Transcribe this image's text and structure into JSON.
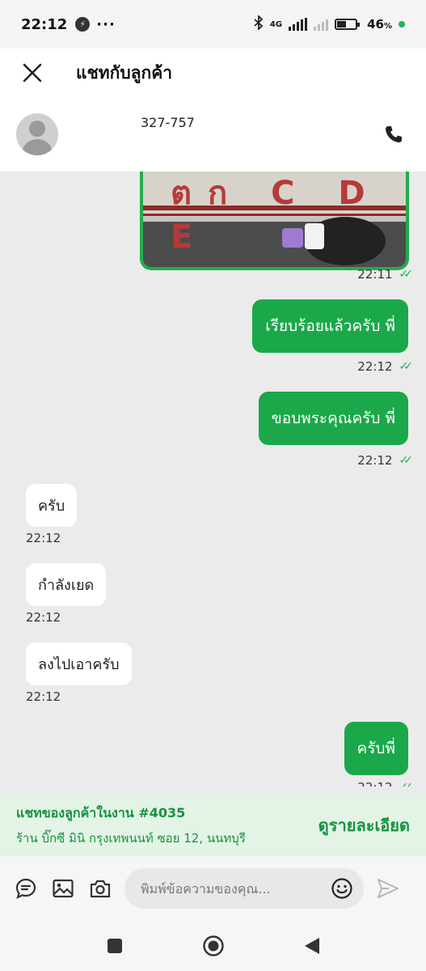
{
  "status_bar": {
    "time": "22:12",
    "dots": "···",
    "network": "4G",
    "battery": "46",
    "battery_unit": "%"
  },
  "header": {
    "title": "แชทกับลูกค้า"
  },
  "contact": {
    "phone_partial": "327-757"
  },
  "chat": {
    "image_caption_text": "ตก C D E",
    "image_time": "22:11",
    "outgoing": [
      {
        "text": "เรียบร้อยแล้วครับ พี่",
        "time": "22:12"
      },
      {
        "text": "ขอบพระคุณครับ พี่",
        "time": "22:12"
      },
      {
        "text": "ครับพี่",
        "time": "22:12"
      }
    ],
    "incoming": [
      {
        "text": "ครับ",
        "time": "22:12"
      },
      {
        "text": "กำลังเยด",
        "time": "22:12"
      },
      {
        "text": "ลงไปเอาครับ",
        "time": "22:12"
      }
    ]
  },
  "job_banner": {
    "title": "แชทของลูกค้าในงาน #4035",
    "subtitle": "ร้าน บิ๊กซี มินิ กรุงเทพนนท์ ซอย 12, นนทบุรี",
    "link_label": "ดูรายละเอียด"
  },
  "composer": {
    "placeholder": "พิมพ์ข้อความของคุณ..."
  },
  "colors": {
    "accent": "#1aa84a",
    "banner_bg": "#e3f3e6",
    "chat_bg": "#ebebeb"
  },
  "icons": [
    "messenger-icon",
    "bluetooth-icon",
    "signal-icon",
    "battery-icon",
    "close-icon",
    "phone-icon",
    "chat-bubble-icon",
    "gallery-icon",
    "camera-icon",
    "emoji-icon",
    "send-icon",
    "nav-recents-icon",
    "nav-home-icon",
    "nav-back-icon"
  ]
}
